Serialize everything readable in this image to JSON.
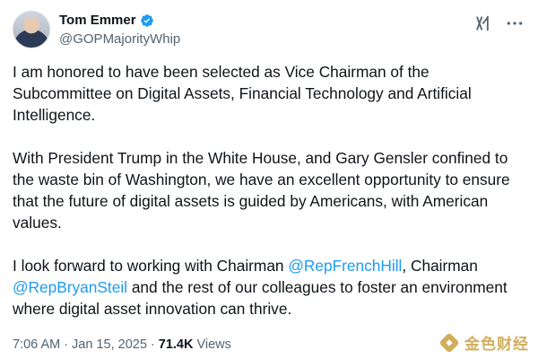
{
  "author": {
    "display_name": "Tom Emmer",
    "handle": "@GOPMajorityWhip",
    "verified": true,
    "avatar_icon": "avatar-photo",
    "verified_color": "#1d9bf0"
  },
  "tweet": {
    "para1": "I am honored to have been selected as Vice Chairman of the Subcommittee on Digital Assets, Financial Technology and Artificial Intelligence.",
    "para2": "With President Trump in the White House, and Gary Gensler confined to the waste bin of Washington, we have an excellent opportunity to ensure that the future of digital assets is guided by Americans, with American values.",
    "para3_before": "I look forward to working with Chairman ",
    "mention1": "@RepFrenchHill",
    "para3_mid": ", Chairman ",
    "mention2": "@RepBryanSteil",
    "para3_after": " and the rest of our colleagues to foster an environment where digital asset innovation can thrive."
  },
  "meta": {
    "time": "7:06 AM",
    "separator": "·",
    "date": "Jan 15, 2025",
    "views_count": "71.4K",
    "views_label": "Views"
  },
  "icons": {
    "grok": "grok-icon",
    "more": "more-icon"
  },
  "watermark": {
    "text": "金色财经",
    "color": "#c9a040"
  },
  "colors": {
    "link": "#1d9bf0",
    "secondary_text": "#536471",
    "primary_text": "#0f1419"
  }
}
